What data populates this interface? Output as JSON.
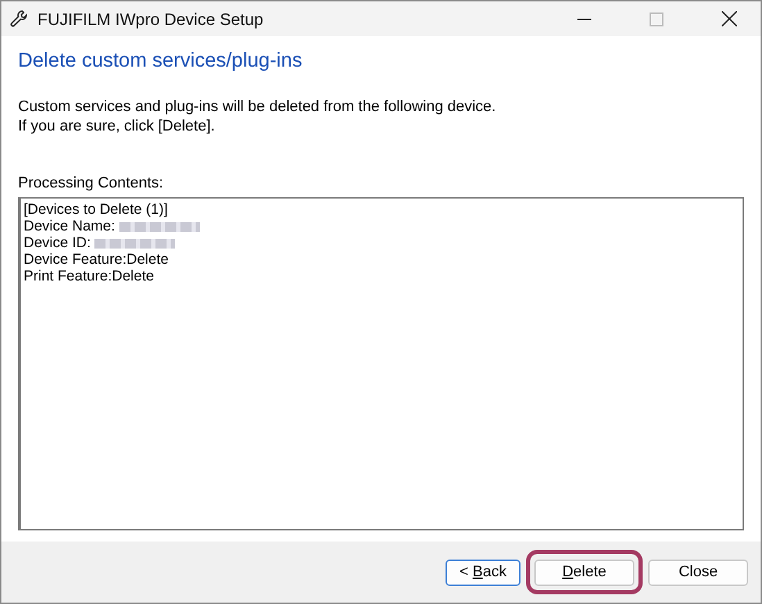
{
  "window": {
    "title": "FUJIFILM IWpro Device Setup"
  },
  "heading": "Delete custom services/plug-ins",
  "message": [
    "Custom services and plug-ins will be deleted from the following device.",
    "If you are sure, click [Delete]."
  ],
  "contents_label": "Processing Contents:",
  "contents_lines": [
    {
      "text": "[Devices to Delete (1)]",
      "redacted": false
    },
    {
      "text": "Device Name:",
      "redacted": true
    },
    {
      "text": "Device ID:",
      "redacted": true
    },
    {
      "text": "Device Feature:Delete",
      "redacted": false
    },
    {
      "text": "Print Feature:Delete",
      "redacted": false
    }
  ],
  "buttons": [
    {
      "before": "< ",
      "key": "B",
      "after": "ack",
      "highlighted": false,
      "focused": true
    },
    {
      "key": "D",
      "after": "elete",
      "highlighted": true,
      "focused": false
    },
    {
      "after": "Close",
      "highlighted": false,
      "focused": false
    }
  ]
}
